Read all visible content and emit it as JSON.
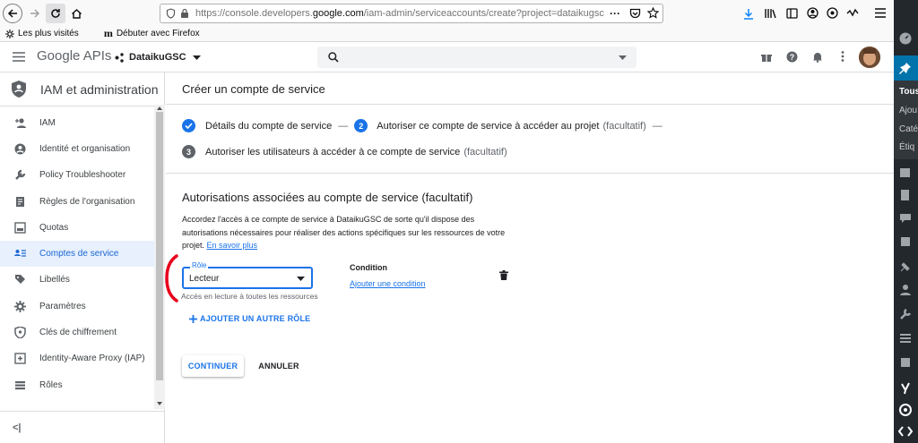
{
  "browser": {
    "url_prefix": "https://console.developers.",
    "url_host": "google.com",
    "url_suffix": "/iam-admin/serviceaccounts/create?project=dataikugsc",
    "url_more": "···",
    "bookmarks": [
      "Les plus visités",
      "Débuter avec Firefox"
    ]
  },
  "header": {
    "logo_google": "Google",
    "logo_apis": "APIs",
    "project_name": "DataikuGSC"
  },
  "nav": {
    "title": "IAM et administration",
    "items": [
      {
        "label": "IAM",
        "icon": "person-add-icon"
      },
      {
        "label": "Identité et organisation",
        "icon": "account-circle-icon"
      },
      {
        "label": "Policy Troubleshooter",
        "icon": "wrench-icon"
      },
      {
        "label": "Règles de l'organisation",
        "icon": "document-icon"
      },
      {
        "label": "Quotas",
        "icon": "quota-icon"
      },
      {
        "label": "Comptes de service",
        "icon": "service-account-icon"
      },
      {
        "label": "Libellés",
        "icon": "label-icon"
      },
      {
        "label": "Paramètres",
        "icon": "gear-icon"
      },
      {
        "label": "Clés de chiffrement",
        "icon": "shield-icon"
      },
      {
        "label": "Identity-Aware Proxy (IAP)",
        "icon": "iap-icon"
      },
      {
        "label": "Rôles",
        "icon": "roles-icon"
      }
    ],
    "collapse_label": "<|"
  },
  "main": {
    "page_title": "Créer un compte de service",
    "steps": [
      {
        "label": "Détails du compte de service",
        "suffix": "",
        "status": "done"
      },
      {
        "number": "2",
        "label": "Autoriser ce compte de service à accéder au projet",
        "suffix": "(facultatif)",
        "status": "active"
      },
      {
        "number": "3",
        "label": "Autoriser les utilisateurs à accéder à ce compte de service",
        "suffix": "(facultatif)",
        "status": "pending"
      }
    ],
    "step_separator": "—",
    "section_title": "Autorisations associées au compte de service (facultatif)",
    "description": "Accordez l'accès à ce compte de service à DataikuGSC de sorte qu'il dispose des autorisations nécessaires pour réaliser des actions spécifiques sur les ressources de votre projet.",
    "learn_more": "En savoir plus",
    "role_label": "Rôle",
    "role_value": "Lecteur",
    "role_hint": "Accès en lecture à toutes les ressources",
    "condition_label": "Condition",
    "add_condition": "Ajouter une condition",
    "add_role": "AJOUTER UN AUTRE RÔLE",
    "continue": "CONTINUER",
    "cancel": "ANNULER"
  },
  "wp_sidebar": {
    "items": [
      "Tous",
      "Ajou",
      "Caté",
      "Étiq"
    ]
  },
  "colors": {
    "accent": "#1a73e8",
    "annotation": "#e8001c",
    "wp_bg": "#23282d",
    "active_nav_bg": "#e8f0fe"
  }
}
